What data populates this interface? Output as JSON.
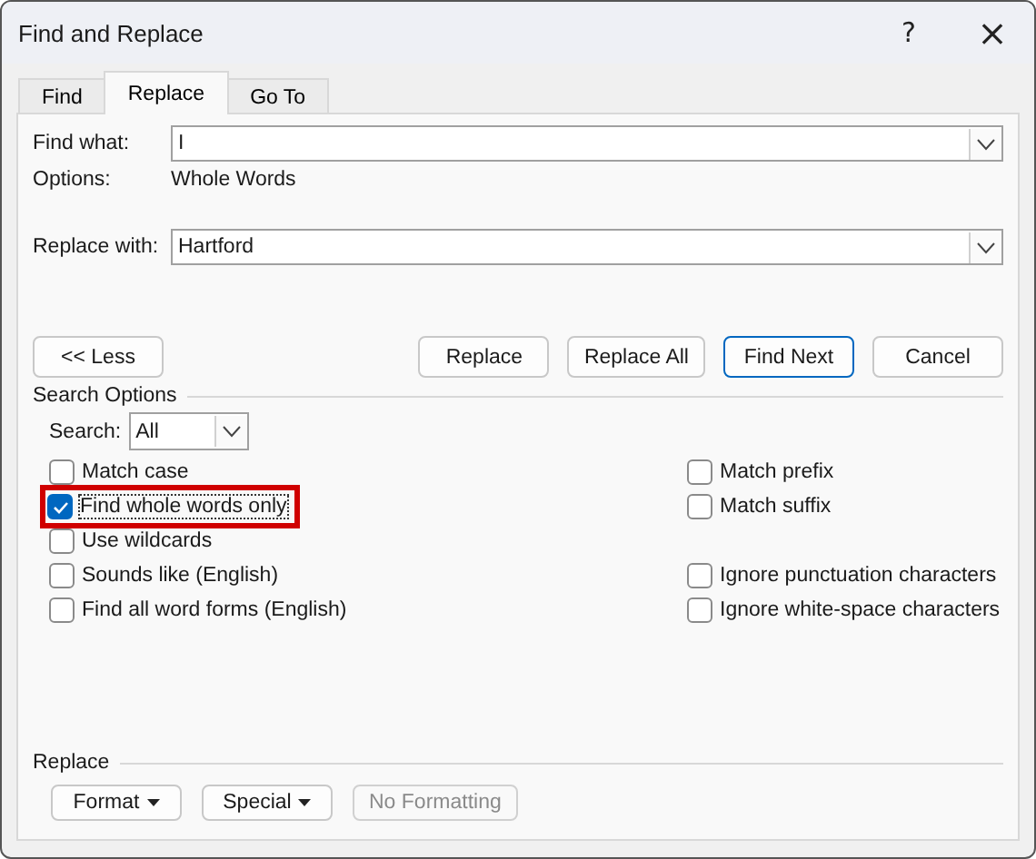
{
  "window": {
    "title": "Find and Replace",
    "help": "?",
    "close": "×"
  },
  "tabs": [
    {
      "label": "Find",
      "selected": false
    },
    {
      "label": "Replace",
      "selected": true
    },
    {
      "label": "Go To",
      "selected": false
    }
  ],
  "find_what": {
    "label": "Find what:",
    "value": "I"
  },
  "options": {
    "label": "Options:",
    "value": "Whole Words"
  },
  "replace_with": {
    "label": "Replace with:",
    "value": "Hartford"
  },
  "less_button": "<< Less",
  "action_buttons": [
    {
      "label": "Replace",
      "default": false
    },
    {
      "label": "Replace All",
      "default": false
    },
    {
      "label": "Find Next",
      "default": true
    },
    {
      "label": "Cancel",
      "default": false
    }
  ],
  "search_options": {
    "heading": "Search Options",
    "search_label": "Search:",
    "search_value": "All"
  },
  "checkboxes_left": [
    {
      "label": "Match case",
      "checked": false,
      "highlighted": false
    },
    {
      "label": "Find whole words only",
      "checked": true,
      "highlighted": true
    },
    {
      "label": "Use wildcards",
      "checked": false,
      "highlighted": false
    },
    {
      "label": "Sounds like (English)",
      "checked": false,
      "highlighted": false
    },
    {
      "label": "Find all word forms (English)",
      "checked": false,
      "highlighted": false
    }
  ],
  "checkboxes_right": [
    {
      "label": "Match prefix",
      "checked": false
    },
    {
      "label": "Match suffix",
      "checked": false
    },
    {
      "label": "Ignore punctuation characters",
      "checked": false
    },
    {
      "label": "Ignore white-space characters",
      "checked": false
    }
  ],
  "replace_section": {
    "heading": "Replace",
    "buttons": [
      {
        "label": "Format",
        "menu": true,
        "disabled": false
      },
      {
        "label": "Special",
        "menu": true,
        "disabled": false
      },
      {
        "label": "No Formatting",
        "menu": false,
        "disabled": true
      }
    ]
  }
}
